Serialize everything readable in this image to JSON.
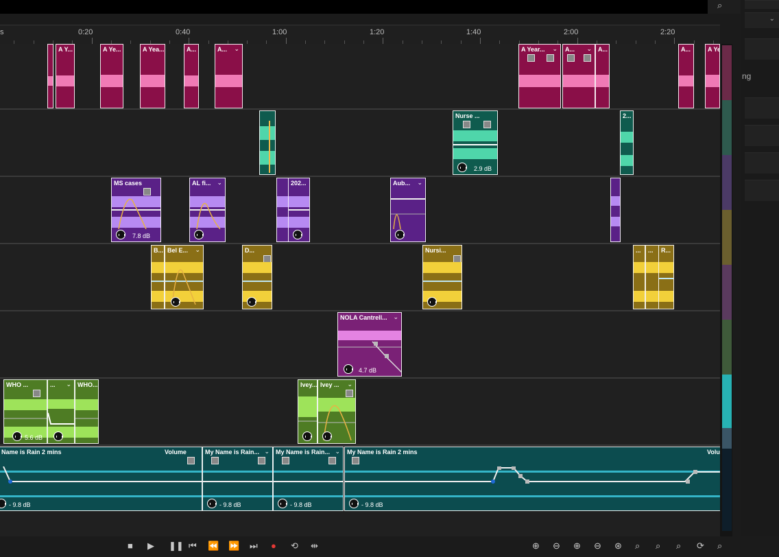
{
  "ruler": {
    "labels": [
      "s",
      "0:20",
      "0:40",
      "1:00",
      "1:20",
      "1:40",
      "2:00",
      "2:20"
    ]
  },
  "panel": {
    "label_partial": "ng"
  },
  "clips": {
    "t1": [
      "A Y...",
      "A Ye...",
      "A Yea...",
      "A...",
      "A...",
      "A Year...",
      "A...",
      "A...",
      "A...",
      "A Ye"
    ],
    "t2": [
      "Nurse ...",
      "2..."
    ],
    "t2_db": "2.9 dB",
    "t3": [
      "MS cases",
      "AL fi...",
      "202...",
      "Aub..."
    ],
    "t3_db": "7.8 dB",
    "t4": [
      "B...",
      "Bel E...",
      "D...",
      "Nursi...",
      "...",
      "...",
      "R..."
    ],
    "t5": [
      "NOLA Cantrell..."
    ],
    "t5_db": "4.7 dB",
    "t6": [
      "WHO ...",
      "...",
      "WHO...",
      "Ivey...",
      "Ivey ..."
    ],
    "t6_db": "5.6 dB",
    "music": [
      "Name is Rain 2 mins",
      "My Name is Rain...",
      "My Name is Rain...",
      "My Name is Rain 2 mins"
    ],
    "music_right": [
      "Volume",
      "Volu"
    ],
    "music_db": "- 9.8 dB"
  },
  "colors": {
    "pink": "#8a0f48",
    "teal": "#0f5b4e",
    "purple": "#5a2187",
    "gold": "#8a6f16",
    "magenta": "#7a2176",
    "green": "#4e7c24",
    "music": "#0c4c4f",
    "wave_pink": "#f07ab5",
    "wave_teal": "#4fd6aa",
    "wave_purple": "#b78af2",
    "wave_gold": "#f2d03a",
    "wave_magenta": "#e483e2",
    "wave_green": "#9ee35a",
    "wave_music": "#34b5c8"
  }
}
